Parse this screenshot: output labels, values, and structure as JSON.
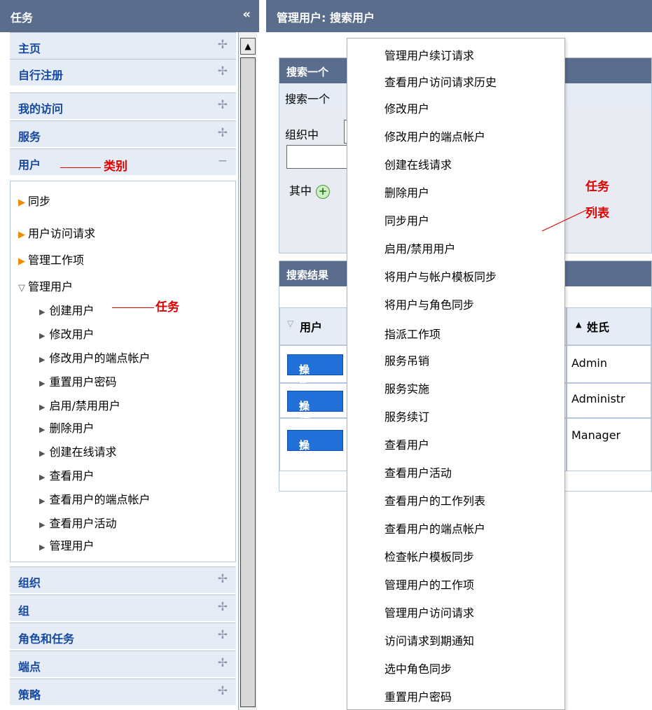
{
  "left_panel": {
    "title": "任务",
    "collapse_glyph": "«",
    "categories_top": [
      {
        "label": "主页",
        "toggle": "✢"
      },
      {
        "label": "自行注册",
        "toggle": "✢"
      },
      {
        "label": "我的访问",
        "toggle": "✢"
      },
      {
        "label": "服务",
        "toggle": "✢"
      },
      {
        "label": "用户",
        "toggle": "−"
      }
    ],
    "subcategories": [
      {
        "label": "同步",
        "arrow": "▶"
      },
      {
        "label": "用户访问请求",
        "arrow": "▶"
      },
      {
        "label": "管理工作项",
        "arrow": "▶"
      },
      {
        "label": "管理用户",
        "arrow": "▽"
      }
    ],
    "tasks": [
      "创建用户",
      "修改用户",
      "修改用户的端点帐户",
      "重置用户密码",
      "启用/禁用用户",
      "删除用户",
      "创建在线请求",
      "查看用户",
      "查看用户的端点帐户",
      "查看用户活动",
      "管理用户"
    ],
    "task_glyph": "▶",
    "categories_bottom": [
      {
        "label": "组织",
        "toggle": "✢"
      },
      {
        "label": "组",
        "toggle": "✢"
      },
      {
        "label": "角色和任务",
        "toggle": "✢"
      },
      {
        "label": "端点",
        "toggle": "✢"
      },
      {
        "label": "策略",
        "toggle": "✢"
      }
    ]
  },
  "annotations": {
    "category": "类别",
    "task": "任务",
    "task_list_1": "任务",
    "task_list_2": "列表"
  },
  "main": {
    "title": "管理用户: 搜索用户",
    "search": {
      "header": "搜索一个",
      "line1": "搜索一个",
      "line2": "组织中",
      "where": "其中",
      "add_glyph": "+"
    },
    "results": {
      "header": "搜索结果",
      "col_user": "用户",
      "col_user_sort": "▽",
      "col_surname": "姓氏",
      "col_surname_sort": "▲",
      "action_label": "操作",
      "action_caret": "▾",
      "rows": [
        {
          "surname": "Admin"
        },
        {
          "surname": "Administr"
        },
        {
          "surname": "Manager"
        }
      ]
    }
  },
  "menu": {
    "items": [
      "管理用户续订请求",
      "查看用户访问请求历史",
      "修改用户",
      "修改用户的端点帐户",
      "创建在线请求",
      "删除用户",
      "同步用户",
      "启用/禁用用户",
      "将用户与帐户模板同步",
      "将用户与角色同步",
      "指派工作项",
      "服务吊销",
      "服务实施",
      "服务续订",
      "查看用户",
      "查看用户活动",
      "查看用户的工作列表",
      "查看用户的端点帐户",
      "检查帐户模板同步",
      "管理用户的工作项",
      "管理用户访问请求",
      "访问请求到期通知",
      "选中角色同步",
      "重置用户密码"
    ]
  },
  "colors": {
    "header_bg": "#5a6d8d",
    "category_text": "#1548a0",
    "annotation": "#e00000",
    "action_button": "#2170d8"
  }
}
